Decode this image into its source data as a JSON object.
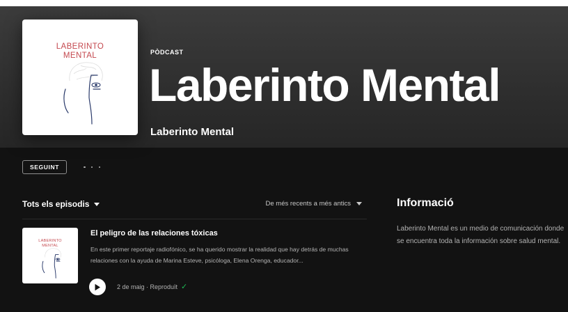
{
  "podcast": {
    "kind_label": "PÒDCAST",
    "title": "Laberinto Mental",
    "author": "Laberinto Mental",
    "cover_title_line1": "LABERINTO",
    "cover_title_line2": "MENTAL"
  },
  "actions": {
    "follow_label": "SEGUINT",
    "more_icon": "more-dots-icon"
  },
  "episodes_section": {
    "heading": "Tots els episodis",
    "sort_label": "De més recents a més antics",
    "episodes": [
      {
        "title": "El peligro de las relaciones tóxicas",
        "description": "En este primer reportaje radiofónico, se ha querido mostrar la realidad que hay detrás de muchas relaciones con la ayuda de Marina Esteve, psicóloga, Elena Orenga, educador...",
        "meta": "2 de maig · Reproduït",
        "played": true
      }
    ]
  },
  "info": {
    "heading": "Informació",
    "text": "Laberinto Mental es un medio de comunicación donde se encuentra toda la información sobre salud mental."
  },
  "colors": {
    "background": "#121212",
    "header_gradient_top": "#3c3c3c",
    "accent_green": "#1db954",
    "cover_red": "#c4484e",
    "cover_navy": "#2a3a6a"
  }
}
